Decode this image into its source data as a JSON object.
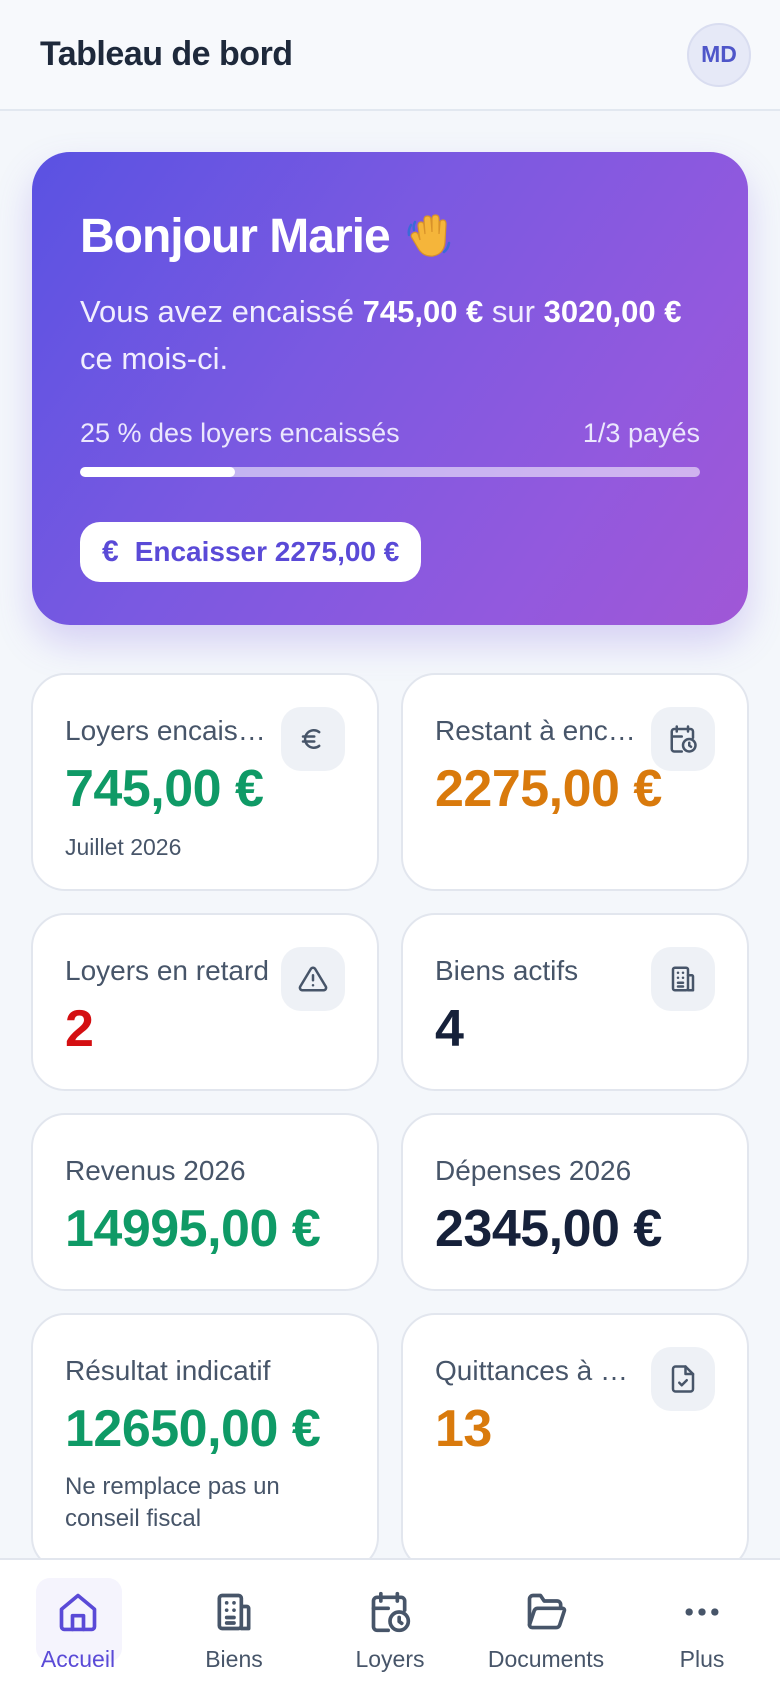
{
  "header": {
    "title": "Tableau de bord",
    "avatar_initials": "MD"
  },
  "hero": {
    "greeting": "Bonjour Marie",
    "emoji": "waving-hand",
    "text_prefix": "Vous avez encaissé ",
    "collected": "745,00 €",
    "text_mid": " sur ",
    "expected": "3020,00 €",
    "text_suffix": " ce mois-ci.",
    "progress_label": "25 % des loyers encaissés",
    "paid_count": "1/3 payés",
    "progress_percent": 25,
    "cta_icon": "€",
    "cta_label": "Encaisser 2275,00 €"
  },
  "cards": {
    "collected": {
      "label": "Loyers encaissés",
      "value": "745,00 €",
      "sub": "Juillet 2026",
      "icon": "euro-icon"
    },
    "remaining": {
      "label": "Restant à encaisser",
      "value": "2275,00 €",
      "icon": "calendar-clock-icon"
    },
    "late": {
      "label": "Loyers en retard",
      "value": "2",
      "icon": "warning-icon"
    },
    "properties": {
      "label": "Biens actifs",
      "value": "4",
      "icon": "building-icon"
    },
    "revenue": {
      "label": "Revenus 2026",
      "value": "14995,00 €"
    },
    "expenses": {
      "label": "Dépenses 2026",
      "value": "2345,00 €"
    },
    "result": {
      "label": "Résultat indicatif",
      "value": "12650,00 €",
      "sub": "Ne remplace pas un conseil fiscal"
    },
    "receipts": {
      "label": "Quittances à générer",
      "value": "13",
      "icon": "file-check-icon"
    }
  },
  "nav": {
    "home": "Accueil",
    "properties": "Biens",
    "rents": "Loyers",
    "documents": "Documents",
    "more": "Plus"
  },
  "colors": {
    "accent": "#5a4ad7",
    "positive": "#0f9a66",
    "warning": "#d97a0c",
    "danger": "#d40f12"
  }
}
